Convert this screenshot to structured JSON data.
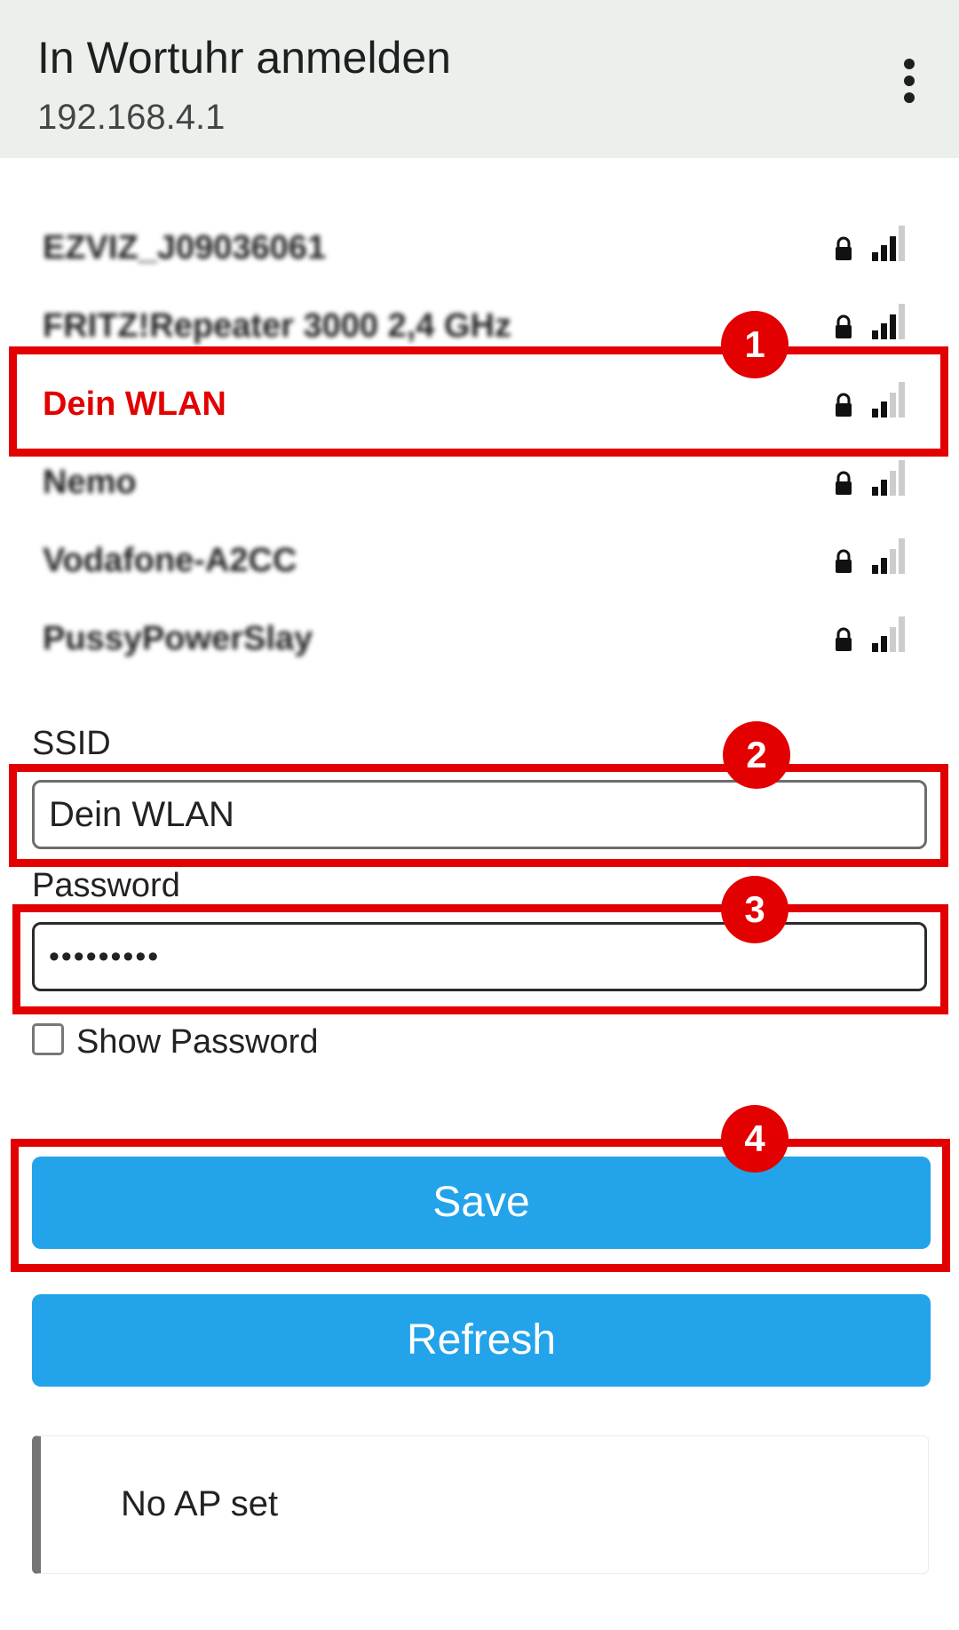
{
  "header": {
    "title": "In Wortuhr anmelden",
    "url": "192.168.4.1",
    "menu_icon": "more-vertical-icon"
  },
  "networks": [
    {
      "ssid": "EZVIZ_J09036061",
      "secured": true,
      "signal_bars": 3,
      "blurred": true
    },
    {
      "ssid": "FRITZ!Repeater 3000 2,4 GHz",
      "secured": true,
      "signal_bars": 3,
      "blurred": true
    },
    {
      "ssid": "Dein WLAN",
      "secured": true,
      "signal_bars": 2,
      "blurred": false,
      "highlighted": true
    },
    {
      "ssid": "Nemo",
      "secured": true,
      "signal_bars": 2,
      "blurred": true
    },
    {
      "ssid": "Vodafone-A2CC",
      "secured": true,
      "signal_bars": 2,
      "blurred": true
    },
    {
      "ssid": "PussyPowerSlay",
      "secured": true,
      "signal_bars": 2,
      "blurred": true
    }
  ],
  "form": {
    "ssid_label": "SSID",
    "ssid_value": "Dein WLAN",
    "password_label": "Password",
    "password_value": "•••••••••",
    "show_password_label": "Show Password",
    "show_password_checked": false
  },
  "buttons": {
    "save": "Save",
    "refresh": "Refresh"
  },
  "status": {
    "text": "No AP set"
  },
  "annotations": [
    "1",
    "2",
    "3",
    "4"
  ],
  "colors": {
    "accent_blue": "#23a3e9",
    "annotation_red": "#e20000",
    "header_bg": "#ecf0ec"
  }
}
